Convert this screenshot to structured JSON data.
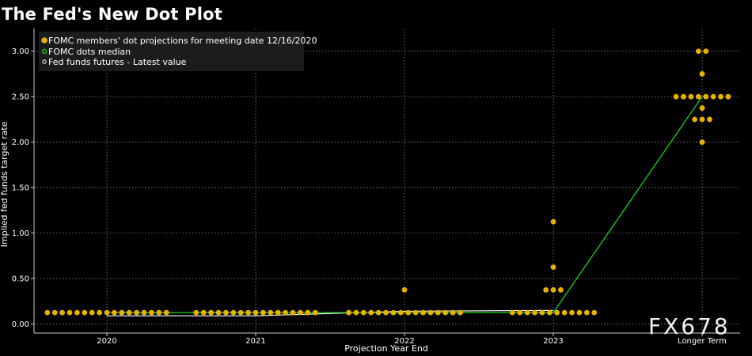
{
  "colors": {
    "background": "#000000",
    "dots": "#e6b000",
    "median_line": "#1fcf1f",
    "futures_line": "#ffffff",
    "grid": "#9a9a9a"
  },
  "watermark": "FX678",
  "chart_data": {
    "type": "scatter",
    "title": "The Fed's New Dot Plot",
    "xlabel": "Projection Year End",
    "ylabel": "Implied fed funds target rate",
    "categories": [
      "2020",
      "2021",
      "2022",
      "2023",
      "Longer Term"
    ],
    "ylim": [
      -0.1,
      3.25
    ],
    "yticks": [
      0.0,
      0.5,
      1.0,
      1.5,
      2.0,
      2.5,
      3.0
    ],
    "ytick_labels": [
      "0.00",
      "0.50",
      "1.00",
      "1.50",
      "2.00",
      "2.50",
      "3.00"
    ],
    "grid": true,
    "legend_position": "top-left",
    "series": [
      {
        "name": "FOMC members' dot projections for meeting date 12/16/2020",
        "kind": "dots",
        "dots": [
          {
            "category": "2020",
            "rate": 0.125,
            "count": 17
          },
          {
            "category": "2021",
            "rate": 0.125,
            "count": 17
          },
          {
            "category": "2022",
            "rate": 0.125,
            "count": 16
          },
          {
            "category": "2022",
            "rate": 0.375,
            "count": 1
          },
          {
            "category": "2023",
            "rate": 0.125,
            "count": 12
          },
          {
            "category": "2023",
            "rate": 0.375,
            "count": 3
          },
          {
            "category": "2023",
            "rate": 0.625,
            "count": 1
          },
          {
            "category": "2023",
            "rate": 1.125,
            "count": 1
          },
          {
            "category": "Longer Term",
            "rate": 2.0,
            "count": 1
          },
          {
            "category": "Longer Term",
            "rate": 2.25,
            "count": 3
          },
          {
            "category": "Longer Term",
            "rate": 2.375,
            "count": 1
          },
          {
            "category": "Longer Term",
            "rate": 2.5,
            "count": 8
          },
          {
            "category": "Longer Term",
            "rate": 2.75,
            "count": 1
          },
          {
            "category": "Longer Term",
            "rate": 3.0,
            "count": 2
          }
        ]
      },
      {
        "name": "FOMC dots median",
        "kind": "line",
        "values": [
          0.125,
          0.125,
          0.125,
          0.125,
          2.5
        ]
      },
      {
        "name": "Fed funds futures - Latest value",
        "kind": "line",
        "points": [
          {
            "category": "2020",
            "rate": 0.09
          },
          {
            "category": "2021",
            "rate": 0.09
          },
          {
            "category": "2022",
            "rate": 0.14
          },
          {
            "category": "2023",
            "rate": 0.15
          }
        ]
      }
    ]
  }
}
